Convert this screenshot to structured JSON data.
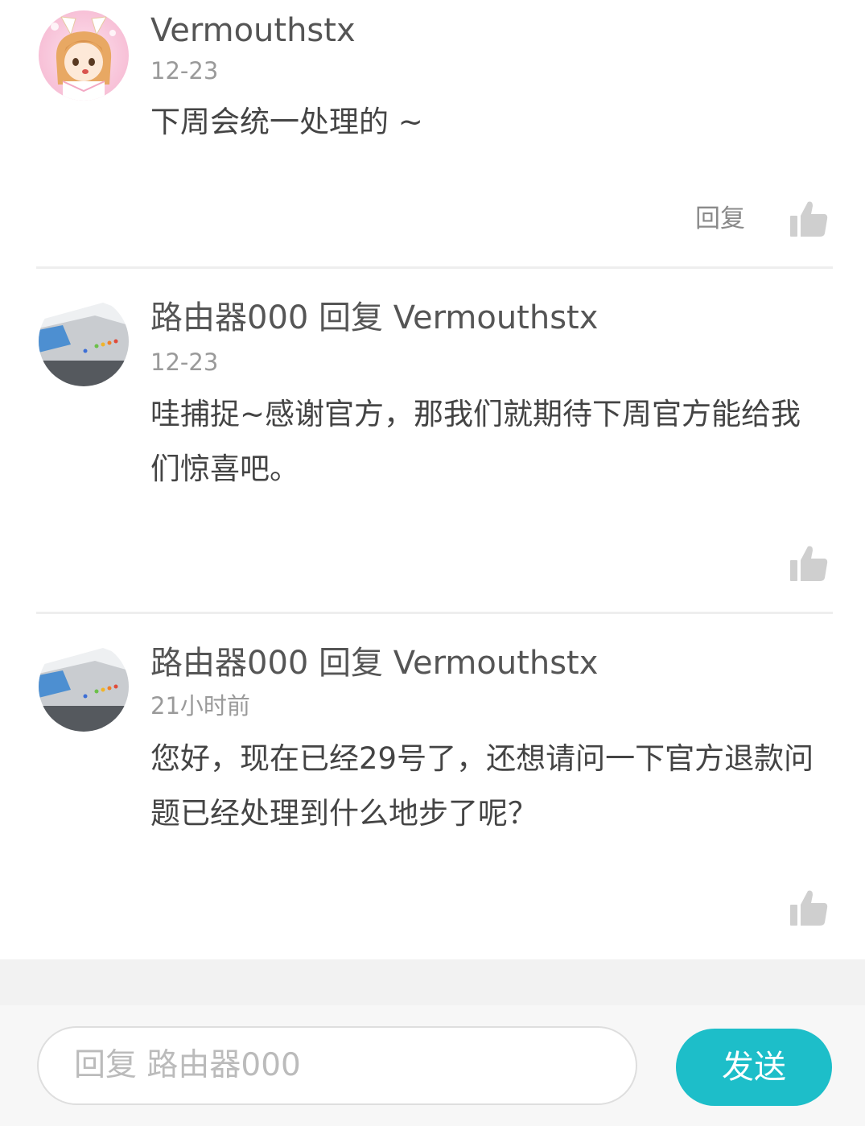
{
  "comments": [
    {
      "author": "Vermouthstx",
      "time": "12-23",
      "content": "下周会统一处理的 ~",
      "reply_label": "回复",
      "avatar": "anime-girl-avatar"
    },
    {
      "author": "路由器000 回复 Vermouthstx",
      "time": "12-23",
      "content": "哇捕捉~感谢官方，那我们就期待下周官方能给我们惊喜吧。",
      "avatar": "router-avatar"
    },
    {
      "author": "路由器000 回复 Vermouthstx",
      "time": "21小时前",
      "content": "您好，现在已经29号了，还想请问一下官方退款问题已经处理到什么地步了呢？",
      "avatar": "router-avatar"
    }
  ],
  "reply_bar": {
    "placeholder": "回复 路由器000",
    "send_label": "发送"
  },
  "colors": {
    "accent": "#1dbec9",
    "like_icon": "#cfcfcf"
  },
  "icons": {
    "like": "thumbs-up-icon"
  }
}
